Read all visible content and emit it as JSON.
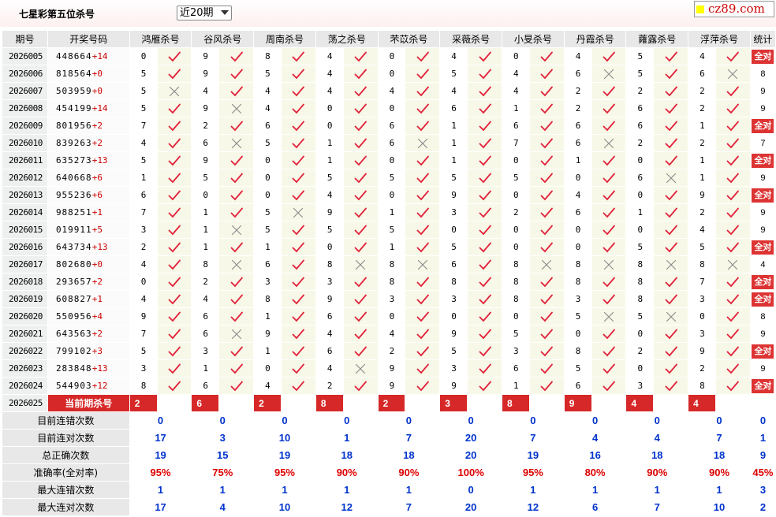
{
  "header": {
    "title": "七星彩第五位杀号",
    "period_select": "近20期",
    "logo_text": "cz89.com"
  },
  "columns": {
    "period": "期号",
    "draw": "开奖号码",
    "experts": [
      "鸿雁杀号",
      "谷风杀号",
      "周南杀号",
      "荡之杀号",
      "芣苡杀号",
      "采薇杀号",
      "小旻杀号",
      "丹霞杀号",
      "蕹露杀号",
      "浮萍杀号"
    ],
    "stats": "统计"
  },
  "rows": [
    {
      "period": "2026005",
      "draw": "448664",
      "code": "14",
      "kills": [
        [
          "0",
          "y"
        ],
        [
          "9",
          "y"
        ],
        [
          "8",
          "y"
        ],
        [
          "4",
          "y"
        ],
        [
          "0",
          "y"
        ],
        [
          "4",
          "y"
        ],
        [
          "0",
          "y"
        ],
        [
          "4",
          "y"
        ],
        [
          "5",
          "y"
        ],
        [
          "4",
          "y"
        ]
      ],
      "stat": "全对"
    },
    {
      "period": "2026006",
      "draw": "818564",
      "code": "0",
      "kills": [
        [
          "5",
          "y"
        ],
        [
          "9",
          "y"
        ],
        [
          "5",
          "y"
        ],
        [
          "4",
          "y"
        ],
        [
          "0",
          "y"
        ],
        [
          "5",
          "y"
        ],
        [
          "4",
          "y"
        ],
        [
          "6",
          "n"
        ],
        [
          "5",
          "y"
        ],
        [
          "6",
          "n"
        ]
      ],
      "stat": "8"
    },
    {
      "period": "2026007",
      "draw": "503959",
      "code": "0",
      "kills": [
        [
          "5",
          "n"
        ],
        [
          "4",
          "y"
        ],
        [
          "4",
          "y"
        ],
        [
          "4",
          "y"
        ],
        [
          "4",
          "y"
        ],
        [
          "4",
          "y"
        ],
        [
          "4",
          "y"
        ],
        [
          "2",
          "y"
        ],
        [
          "2",
          "y"
        ],
        [
          "2",
          "y"
        ]
      ],
      "stat": "9"
    },
    {
      "period": "2026008",
      "draw": "454199",
      "code": "14",
      "kills": [
        [
          "5",
          "y"
        ],
        [
          "9",
          "n"
        ],
        [
          "4",
          "y"
        ],
        [
          "0",
          "y"
        ],
        [
          "0",
          "y"
        ],
        [
          "6",
          "y"
        ],
        [
          "1",
          "y"
        ],
        [
          "2",
          "y"
        ],
        [
          "6",
          "y"
        ],
        [
          "2",
          "y"
        ]
      ],
      "stat": "9"
    },
    {
      "period": "2026009",
      "draw": "801956",
      "code": "2",
      "kills": [
        [
          "7",
          "y"
        ],
        [
          "2",
          "y"
        ],
        [
          "6",
          "y"
        ],
        [
          "0",
          "y"
        ],
        [
          "6",
          "y"
        ],
        [
          "1",
          "y"
        ],
        [
          "6",
          "y"
        ],
        [
          "6",
          "y"
        ],
        [
          "6",
          "y"
        ],
        [
          "1",
          "y"
        ]
      ],
      "stat": "全对"
    },
    {
      "period": "2026010",
      "draw": "839263",
      "code": "2",
      "kills": [
        [
          "4",
          "y"
        ],
        [
          "6",
          "n"
        ],
        [
          "5",
          "y"
        ],
        [
          "1",
          "y"
        ],
        [
          "6",
          "n"
        ],
        [
          "1",
          "y"
        ],
        [
          "7",
          "y"
        ],
        [
          "6",
          "n"
        ],
        [
          "2",
          "y"
        ],
        [
          "2",
          "y"
        ]
      ],
      "stat": "7"
    },
    {
      "period": "2026011",
      "draw": "635273",
      "code": "13",
      "kills": [
        [
          "5",
          "y"
        ],
        [
          "9",
          "y"
        ],
        [
          "0",
          "y"
        ],
        [
          "1",
          "y"
        ],
        [
          "0",
          "y"
        ],
        [
          "1",
          "y"
        ],
        [
          "0",
          "y"
        ],
        [
          "1",
          "y"
        ],
        [
          "0",
          "y"
        ],
        [
          "1",
          "y"
        ]
      ],
      "stat": "全对"
    },
    {
      "period": "2026012",
      "draw": "640668",
      "code": "6",
      "kills": [
        [
          "1",
          "y"
        ],
        [
          "5",
          "y"
        ],
        [
          "0",
          "y"
        ],
        [
          "5",
          "y"
        ],
        [
          "5",
          "y"
        ],
        [
          "5",
          "y"
        ],
        [
          "5",
          "y"
        ],
        [
          "0",
          "y"
        ],
        [
          "6",
          "n"
        ],
        [
          "1",
          "y"
        ]
      ],
      "stat": "9"
    },
    {
      "period": "2026013",
      "draw": "955236",
      "code": "6",
      "kills": [
        [
          "6",
          "y"
        ],
        [
          "0",
          "y"
        ],
        [
          "0",
          "y"
        ],
        [
          "4",
          "y"
        ],
        [
          "0",
          "y"
        ],
        [
          "9",
          "y"
        ],
        [
          "0",
          "y"
        ],
        [
          "4",
          "y"
        ],
        [
          "0",
          "y"
        ],
        [
          "9",
          "y"
        ]
      ],
      "stat": "全对"
    },
    {
      "period": "2026014",
      "draw": "988251",
      "code": "1",
      "kills": [
        [
          "7",
          "y"
        ],
        [
          "1",
          "y"
        ],
        [
          "5",
          "n"
        ],
        [
          "9",
          "y"
        ],
        [
          "1",
          "y"
        ],
        [
          "3",
          "y"
        ],
        [
          "2",
          "y"
        ],
        [
          "6",
          "y"
        ],
        [
          "1",
          "y"
        ],
        [
          "2",
          "y"
        ]
      ],
      "stat": "9"
    },
    {
      "period": "2026015",
      "draw": "019911",
      "code": "5",
      "kills": [
        [
          "3",
          "y"
        ],
        [
          "1",
          "n"
        ],
        [
          "5",
          "y"
        ],
        [
          "5",
          "y"
        ],
        [
          "5",
          "y"
        ],
        [
          "0",
          "y"
        ],
        [
          "0",
          "y"
        ],
        [
          "0",
          "y"
        ],
        [
          "0",
          "y"
        ],
        [
          "4",
          "y"
        ]
      ],
      "stat": "9"
    },
    {
      "period": "2026016",
      "draw": "643734",
      "code": "13",
      "kills": [
        [
          "2",
          "y"
        ],
        [
          "1",
          "y"
        ],
        [
          "1",
          "y"
        ],
        [
          "0",
          "y"
        ],
        [
          "1",
          "y"
        ],
        [
          "5",
          "y"
        ],
        [
          "0",
          "y"
        ],
        [
          "0",
          "y"
        ],
        [
          "5",
          "y"
        ],
        [
          "5",
          "y"
        ]
      ],
      "stat": "全对"
    },
    {
      "period": "2026017",
      "draw": "802680",
      "code": "0",
      "kills": [
        [
          "4",
          "y"
        ],
        [
          "8",
          "n"
        ],
        [
          "6",
          "y"
        ],
        [
          "8",
          "n"
        ],
        [
          "8",
          "n"
        ],
        [
          "6",
          "y"
        ],
        [
          "8",
          "n"
        ],
        [
          "8",
          "n"
        ],
        [
          "8",
          "n"
        ],
        [
          "8",
          "n"
        ]
      ],
      "stat": "4"
    },
    {
      "period": "2026018",
      "draw": "293657",
      "code": "2",
      "kills": [
        [
          "0",
          "y"
        ],
        [
          "2",
          "y"
        ],
        [
          "3",
          "y"
        ],
        [
          "3",
          "y"
        ],
        [
          "8",
          "y"
        ],
        [
          "8",
          "y"
        ],
        [
          "8",
          "y"
        ],
        [
          "8",
          "y"
        ],
        [
          "8",
          "y"
        ],
        [
          "7",
          "y"
        ]
      ],
      "stat": "全对"
    },
    {
      "period": "2026019",
      "draw": "608827",
      "code": "1",
      "kills": [
        [
          "4",
          "y"
        ],
        [
          "4",
          "y"
        ],
        [
          "8",
          "y"
        ],
        [
          "9",
          "y"
        ],
        [
          "3",
          "y"
        ],
        [
          "3",
          "y"
        ],
        [
          "8",
          "y"
        ],
        [
          "3",
          "y"
        ],
        [
          "8",
          "y"
        ],
        [
          "3",
          "y"
        ]
      ],
      "stat": "全对"
    },
    {
      "period": "2026020",
      "draw": "550956",
      "code": "4",
      "kills": [
        [
          "9",
          "y"
        ],
        [
          "6",
          "y"
        ],
        [
          "1",
          "y"
        ],
        [
          "6",
          "y"
        ],
        [
          "0",
          "y"
        ],
        [
          "0",
          "y"
        ],
        [
          "0",
          "y"
        ],
        [
          "5",
          "n"
        ],
        [
          "5",
          "n"
        ],
        [
          "0",
          "y"
        ]
      ],
      "stat": "8"
    },
    {
      "period": "2026021",
      "draw": "643563",
      "code": "2",
      "kills": [
        [
          "7",
          "y"
        ],
        [
          "6",
          "n"
        ],
        [
          "9",
          "y"
        ],
        [
          "4",
          "y"
        ],
        [
          "4",
          "y"
        ],
        [
          "9",
          "y"
        ],
        [
          "5",
          "y"
        ],
        [
          "0",
          "y"
        ],
        [
          "0",
          "y"
        ],
        [
          "3",
          "y"
        ]
      ],
      "stat": "9"
    },
    {
      "period": "2026022",
      "draw": "799102",
      "code": "3",
      "kills": [
        [
          "5",
          "y"
        ],
        [
          "3",
          "y"
        ],
        [
          "1",
          "y"
        ],
        [
          "6",
          "y"
        ],
        [
          "2",
          "y"
        ],
        [
          "5",
          "y"
        ],
        [
          "3",
          "y"
        ],
        [
          "8",
          "y"
        ],
        [
          "2",
          "y"
        ],
        [
          "9",
          "y"
        ]
      ],
      "stat": "全对"
    },
    {
      "period": "2026023",
      "draw": "283848",
      "code": "13",
      "kills": [
        [
          "3",
          "y"
        ],
        [
          "1",
          "y"
        ],
        [
          "0",
          "y"
        ],
        [
          "4",
          "n"
        ],
        [
          "9",
          "y"
        ],
        [
          "3",
          "y"
        ],
        [
          "6",
          "y"
        ],
        [
          "5",
          "y"
        ],
        [
          "0",
          "y"
        ],
        [
          "2",
          "y"
        ]
      ],
      "stat": "9"
    },
    {
      "period": "2026024",
      "draw": "544903",
      "code": "12",
      "kills": [
        [
          "8",
          "y"
        ],
        [
          "6",
          "y"
        ],
        [
          "4",
          "y"
        ],
        [
          "2",
          "y"
        ],
        [
          "9",
          "y"
        ],
        [
          "9",
          "y"
        ],
        [
          "1",
          "y"
        ],
        [
          "6",
          "y"
        ],
        [
          "3",
          "y"
        ],
        [
          "8",
          "y"
        ]
      ],
      "stat": "全对"
    }
  ],
  "current": {
    "period": "2026025",
    "label": "当前期杀号",
    "kills": [
      "2",
      "6",
      "2",
      "8",
      "2",
      "3",
      "8",
      "9",
      "4",
      "4"
    ]
  },
  "stats": [
    {
      "label": "目前连错次数",
      "values": [
        "0",
        "0",
        "0",
        "0",
        "0",
        "0",
        "0",
        "0",
        "0",
        "0",
        "0"
      ],
      "kind": "v"
    },
    {
      "label": "目前连对次数",
      "values": [
        "17",
        "3",
        "10",
        "1",
        "7",
        "20",
        "7",
        "4",
        "4",
        "7",
        "1"
      ],
      "kind": "v"
    },
    {
      "label": "总正确次数",
      "values": [
        "19",
        "15",
        "19",
        "18",
        "18",
        "20",
        "19",
        "16",
        "18",
        "18",
        "9"
      ],
      "kind": "v"
    },
    {
      "label": "准确率(全对率)",
      "values": [
        "95%",
        "75%",
        "95%",
        "90%",
        "90%",
        "100%",
        "95%",
        "80%",
        "90%",
        "90%",
        "45%"
      ],
      "kind": "r"
    },
    {
      "label": "最大连错次数",
      "values": [
        "1",
        "1",
        "1",
        "1",
        "1",
        "0",
        "1",
        "1",
        "1",
        "1",
        "3"
      ],
      "kind": "v"
    },
    {
      "label": "最大连对次数",
      "values": [
        "17",
        "4",
        "10",
        "12",
        "7",
        "20",
        "12",
        "6",
        "7",
        "10",
        "2"
      ],
      "kind": "v"
    }
  ],
  "colors": {
    "check": "#e0223a",
    "cross": "#888888",
    "badge": "#d33333",
    "stat_blue": "#0033cc",
    "stat_red": "#dd0000"
  }
}
